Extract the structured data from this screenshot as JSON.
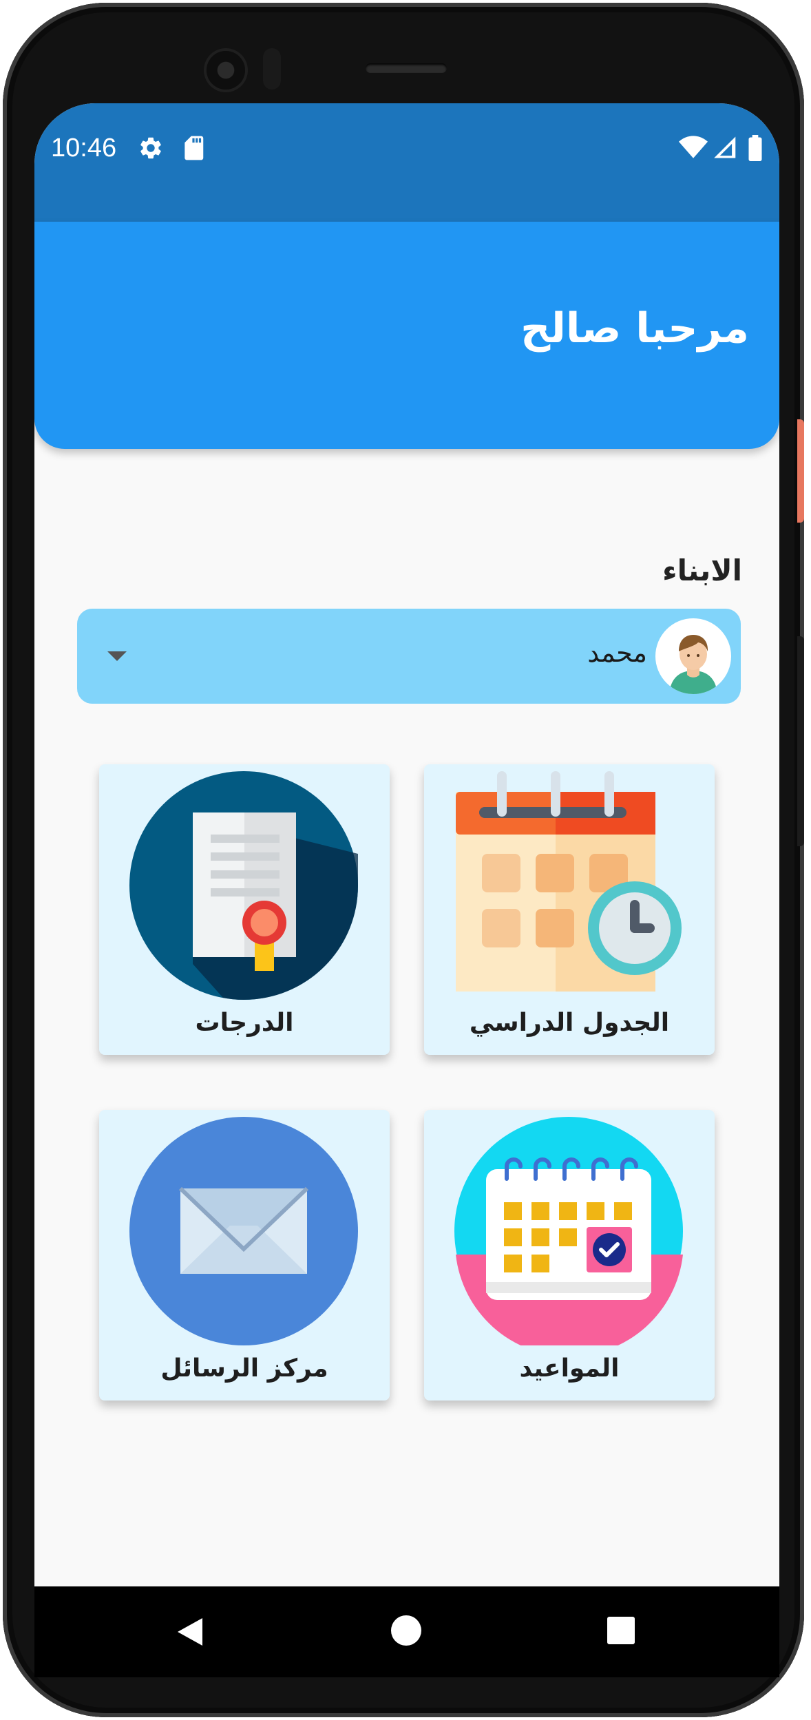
{
  "status_bar": {
    "time": "10:46",
    "icons": [
      "gear-icon",
      "sd-card-icon",
      "wifi-icon",
      "signal-icon",
      "battery-icon"
    ],
    "background": "#1c75bc"
  },
  "app_bar": {
    "title": "مرحبا صالح",
    "background": "#2196f3"
  },
  "children": {
    "label": "الابناء",
    "selected": "محمد",
    "avatar_icon": "boy-avatar-icon",
    "background": "#81d4fa"
  },
  "tiles": [
    {
      "label": "الجدول الدراسي",
      "icon": "calendar-clock-icon"
    },
    {
      "label": "الدرجات",
      "icon": "certificate-icon"
    },
    {
      "label": "المواعيد",
      "icon": "calendar-check-icon"
    },
    {
      "label": "مركز الرسائل",
      "icon": "envelope-icon"
    }
  ],
  "navigation": [
    "back-icon",
    "home-icon",
    "recents-icon"
  ],
  "colors": {
    "tile_background": "#e1f5fe",
    "page_background": "#f9f9f9"
  }
}
